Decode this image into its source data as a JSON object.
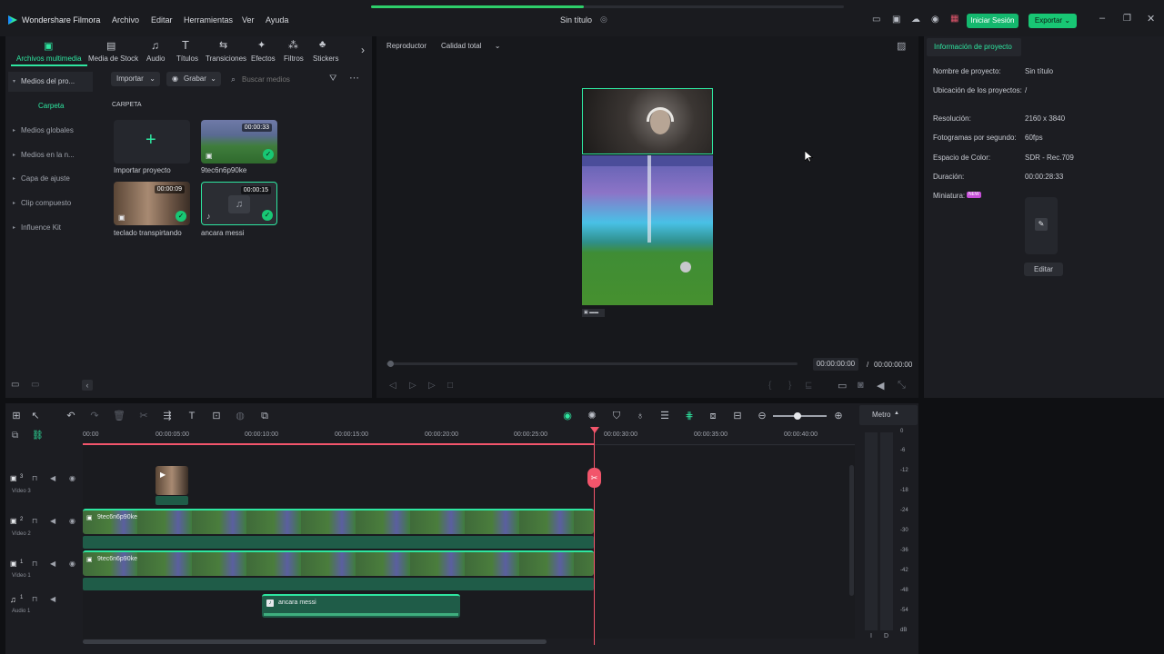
{
  "app": {
    "brand": "Wondershare Filmora",
    "title": "Sin título",
    "menu": [
      "Archivo",
      "Editar",
      "Herramientas",
      "Ver",
      "Ayuda"
    ],
    "login_label": "Iniciar Sesión",
    "export_label": "Exportar",
    "progress_fraction": 0.45
  },
  "media": {
    "tabs": [
      "Archivos multimedia",
      "Media de Stock",
      "Audio",
      "Títulos",
      "Transiciones",
      "Efectos",
      "Filtros",
      "Stickers"
    ],
    "sidebar": [
      "Medios del pro...",
      "Carpeta",
      "Medios globales",
      "Medios en la n...",
      "Capa de ajuste",
      "Clip compuesto",
      "Influence Kit"
    ],
    "toolbar": {
      "import_label": "Importar",
      "record_label": "Grabar",
      "search_placeholder": "Buscar medios"
    },
    "folder_heading": "CARPETA",
    "items": [
      {
        "label": "Importar proyecto",
        "duration": ""
      },
      {
        "label": "9tec6n6p90ke",
        "duration": "00:00:33"
      },
      {
        "label": "teclado transpirtando",
        "duration": "00:00:09"
      },
      {
        "label": "ancara messi",
        "duration": "00:00:15"
      }
    ]
  },
  "player": {
    "tab_label": "Reproductor",
    "quality_label": "Calidad total",
    "current_time": "00:00:00:00",
    "separator": "/",
    "total_time": "00:00:00:00"
  },
  "info": {
    "tab_label": "Información de proyecto",
    "rows": [
      {
        "label": "Nombre de proyecto:",
        "value": "Sin título"
      },
      {
        "label": "Ubicación de los proyectos:",
        "value": "/"
      },
      {
        "label": "Resolución:",
        "value": "2160 x 3840"
      },
      {
        "label": "Fotogramas por segundo:",
        "value": "60fps"
      },
      {
        "label": "Espacio de Color:",
        "value": "SDR - Rec.709"
      },
      {
        "label": "Duración:",
        "value": "00:00:28:33"
      },
      {
        "label": "Miniatura:",
        "value": ""
      }
    ],
    "new_badge": "NEW",
    "edit_label": "Editar"
  },
  "timeline": {
    "meter_label": "Metro",
    "ruler": [
      "00:00",
      "00:00:05:00",
      "00:00:10:00",
      "00:00:15:00",
      "00:00:20:00",
      "00:00:25:00",
      "00:00:30:00",
      "00:00:35:00",
      "00:00:40:00"
    ],
    "tracks": [
      {
        "num": "3",
        "label": "Vídeo 3"
      },
      {
        "num": "2",
        "label": "Vídeo 2"
      },
      {
        "num": "1",
        "label": "Vídeo 1"
      },
      {
        "num": "1",
        "label": "Audio 1"
      }
    ],
    "clips": {
      "video2": "9tec6n6p90ke",
      "video1": "9tec6n6p90ke",
      "audio1": "ancara messi"
    },
    "meter_scale": [
      "0",
      "-6",
      "-12",
      "-18",
      "-24",
      "-30",
      "-36",
      "-42",
      "-48",
      "-54",
      "dB"
    ],
    "meter_channels": [
      "I",
      "D"
    ]
  },
  "colors": {
    "accent": "#18c774",
    "playhead": "#f2556b",
    "panel": "#1c1d22",
    "audio_clip": "#1f5c48"
  }
}
